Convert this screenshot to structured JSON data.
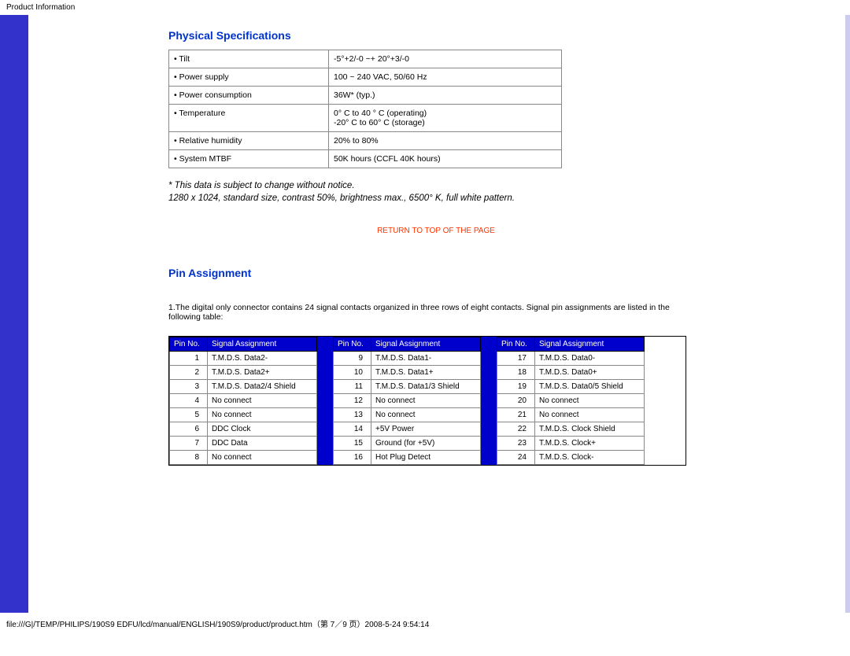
{
  "header_title": "Product Information",
  "sections": {
    "physical_specs": {
      "heading": "Physical Specifications",
      "rows": [
        {
          "label": "• Tilt",
          "value": "-5°+2/-0 ~+ 20°+3/-0"
        },
        {
          "label": "• Power supply",
          "value": "100 ~ 240 VAC, 50/60 Hz"
        },
        {
          "label": "• Power consumption",
          "value": "36W* (typ.)"
        },
        {
          "label": "• Temperature",
          "value": "0° C to 40 ° C (operating)\n-20° C to 60° C (storage)"
        },
        {
          "label": "• Relative humidity",
          "value": "20% to 80%"
        },
        {
          "label": "• System MTBF",
          "value": "50K hours (CCFL 40K hours)"
        }
      ],
      "note1": "* This data is subject to change without notice.",
      "note2": "1280 x 1024, standard size, contrast 50%, brightness max., 6500° K, full white pattern."
    },
    "return_link": "RETURN TO TOP OF THE PAGE",
    "pin_assignment": {
      "heading": "Pin Assignment",
      "intro": "1.The digital only connector contains 24 signal contacts organized in three rows of eight contacts. Signal pin assignments are listed in the following table:",
      "col_headers": {
        "pin": "Pin No.",
        "signal": "Signal Assignment"
      },
      "groups": [
        [
          {
            "pin": "1",
            "signal": "T.M.D.S. Data2-"
          },
          {
            "pin": "2",
            "signal": "T.M.D.S. Data2+"
          },
          {
            "pin": "3",
            "signal": "T.M.D.S. Data2/4 Shield"
          },
          {
            "pin": "4",
            "signal": "No connect"
          },
          {
            "pin": "5",
            "signal": "No connect"
          },
          {
            "pin": "6",
            "signal": "DDC Clock"
          },
          {
            "pin": "7",
            "signal": "DDC Data"
          },
          {
            "pin": "8",
            "signal": "No connect"
          }
        ],
        [
          {
            "pin": "9",
            "signal": "T.M.D.S. Data1-"
          },
          {
            "pin": "10",
            "signal": "T.M.D.S. Data1+"
          },
          {
            "pin": "11",
            "signal": "T.M.D.S. Data1/3 Shield"
          },
          {
            "pin": "12",
            "signal": "No connect"
          },
          {
            "pin": "13",
            "signal": "No connect"
          },
          {
            "pin": "14",
            "signal": "+5V Power"
          },
          {
            "pin": "15",
            "signal": "Ground (for +5V)"
          },
          {
            "pin": "16",
            "signal": "Hot Plug Detect"
          }
        ],
        [
          {
            "pin": "17",
            "signal": "T.M.D.S. Data0-"
          },
          {
            "pin": "18",
            "signal": "T.M.D.S. Data0+"
          },
          {
            "pin": "19",
            "signal": "T.M.D.S. Data0/5 Shield"
          },
          {
            "pin": "20",
            "signal": "No connect"
          },
          {
            "pin": "21",
            "signal": "No connect"
          },
          {
            "pin": "22",
            "signal": "T.M.D.S. Clock Shield"
          },
          {
            "pin": "23",
            "signal": "T.M.D.S. Clock+"
          },
          {
            "pin": "24",
            "signal": "T.M.D.S. Clock-"
          }
        ]
      ]
    }
  },
  "footer": "file:///G|/TEMP/PHILIPS/190S9 EDFU/lcd/manual/ENGLISH/190S9/product/product.htm（第 7／9 页）2008-5-24 9:54:14"
}
